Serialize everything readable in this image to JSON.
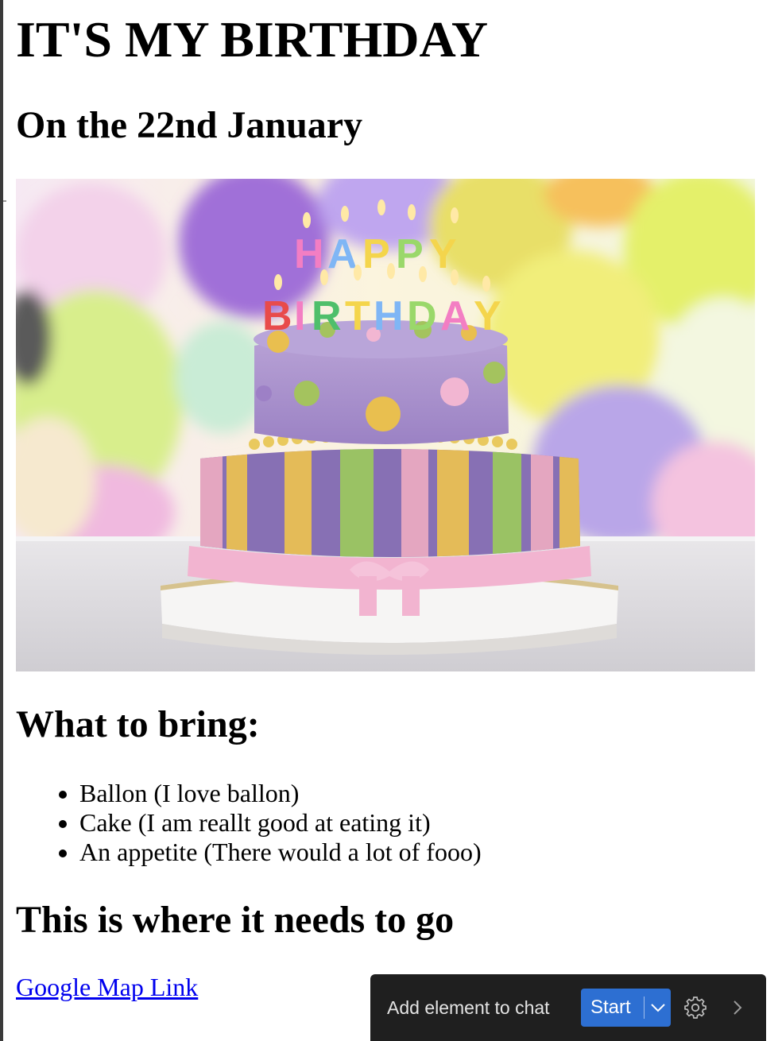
{
  "page": {
    "title": "IT'S MY BIRTHDAY",
    "date_heading": "On the 22nd January",
    "bring_heading": "What to bring:",
    "bring_items": [
      "Ballon (I love ballon)",
      "Cake (I am reallt good at eating it)",
      "An appetite (There would a lot of fooo)"
    ],
    "where_heading": "This is where it needs to go",
    "map_link_label": "Google Map Link"
  },
  "toolbar": {
    "add_label": "Add element to chat",
    "start_label": "Start",
    "dropdown_icon": "chevron-down-icon",
    "settings_icon": "gear-icon",
    "next_icon": "chevron-right-icon",
    "colors": {
      "background": "#1f1f1f",
      "accent": "#2d6fd2"
    }
  },
  "image": {
    "cake_topper_line1": "HAPPY",
    "cake_topper_line2": "BIRTHDAY"
  }
}
